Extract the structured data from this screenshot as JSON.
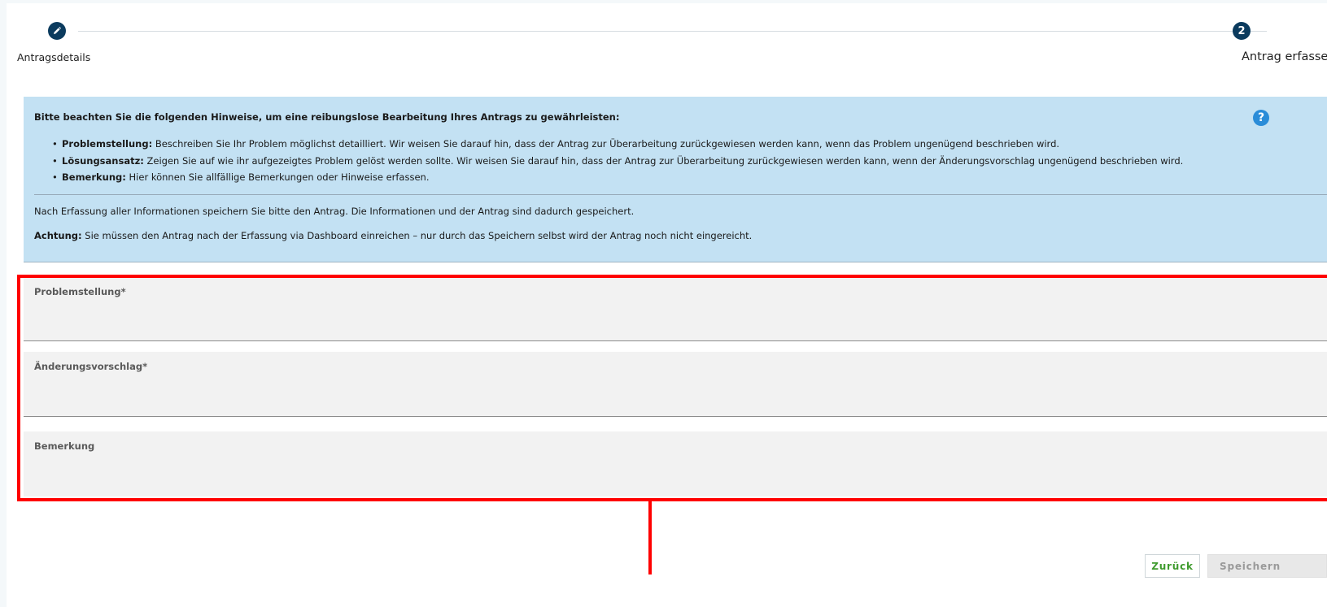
{
  "stepper": {
    "steps": [
      {
        "label": "Antragsdetails",
        "icon": "pencil-icon",
        "number": ""
      },
      {
        "label": "Antrag erfassen",
        "icon": "",
        "number": "2"
      }
    ]
  },
  "info": {
    "title": "Bitte beachten Sie die folgenden Hinweise, um eine reibungslose Bearbeitung Ihres Antrags zu gewährleisten:",
    "help_icon": "?",
    "items": [
      {
        "term": "Problemstellung:",
        "text": " Beschreiben Sie Ihr Problem möglichst detailliert. Wir weisen Sie darauf hin, dass der Antrag zur Überarbeitung zurückgewiesen werden kann, wenn das Problem ungenügend beschrieben wird."
      },
      {
        "term": "Lösungsansatz:",
        "text": " Zeigen Sie auf wie ihr aufgezeigtes Problem gelöst werden sollte. Wir weisen Sie darauf hin, dass der Antrag zur Überarbeitung zurückgewiesen werden kann, wenn der Änderungsvorschlag ungenügend beschrieben wird."
      },
      {
        "term": "Bemerkung:",
        "text": " Hier können Sie allfällige Bemerkungen oder Hinweise erfassen."
      }
    ],
    "paragraph1": "Nach Erfassung aller Informationen speichern Sie bitte den Antrag. Die Informationen und der Antrag sind dadurch gespeichert.",
    "warning_term": "Achtung:",
    "warning_text": " Sie müssen den Antrag nach der Erfassung via Dashboard einreichen – nur durch das Speichern selbst wird der Antrag noch nicht eingereicht."
  },
  "form": {
    "fields": [
      {
        "label": "Problemstellung*",
        "value": ""
      },
      {
        "label": "Änderungsvorschlag*",
        "value": ""
      },
      {
        "label": "Bemerkung",
        "value": ""
      }
    ]
  },
  "buttons": {
    "back": "Zurück",
    "save": "Speichern"
  },
  "colors": {
    "step_dot": "#0b3b5e",
    "info_bg": "#c3e1f3",
    "highlight": "#ff0000",
    "back_text": "#3f9b2e"
  }
}
